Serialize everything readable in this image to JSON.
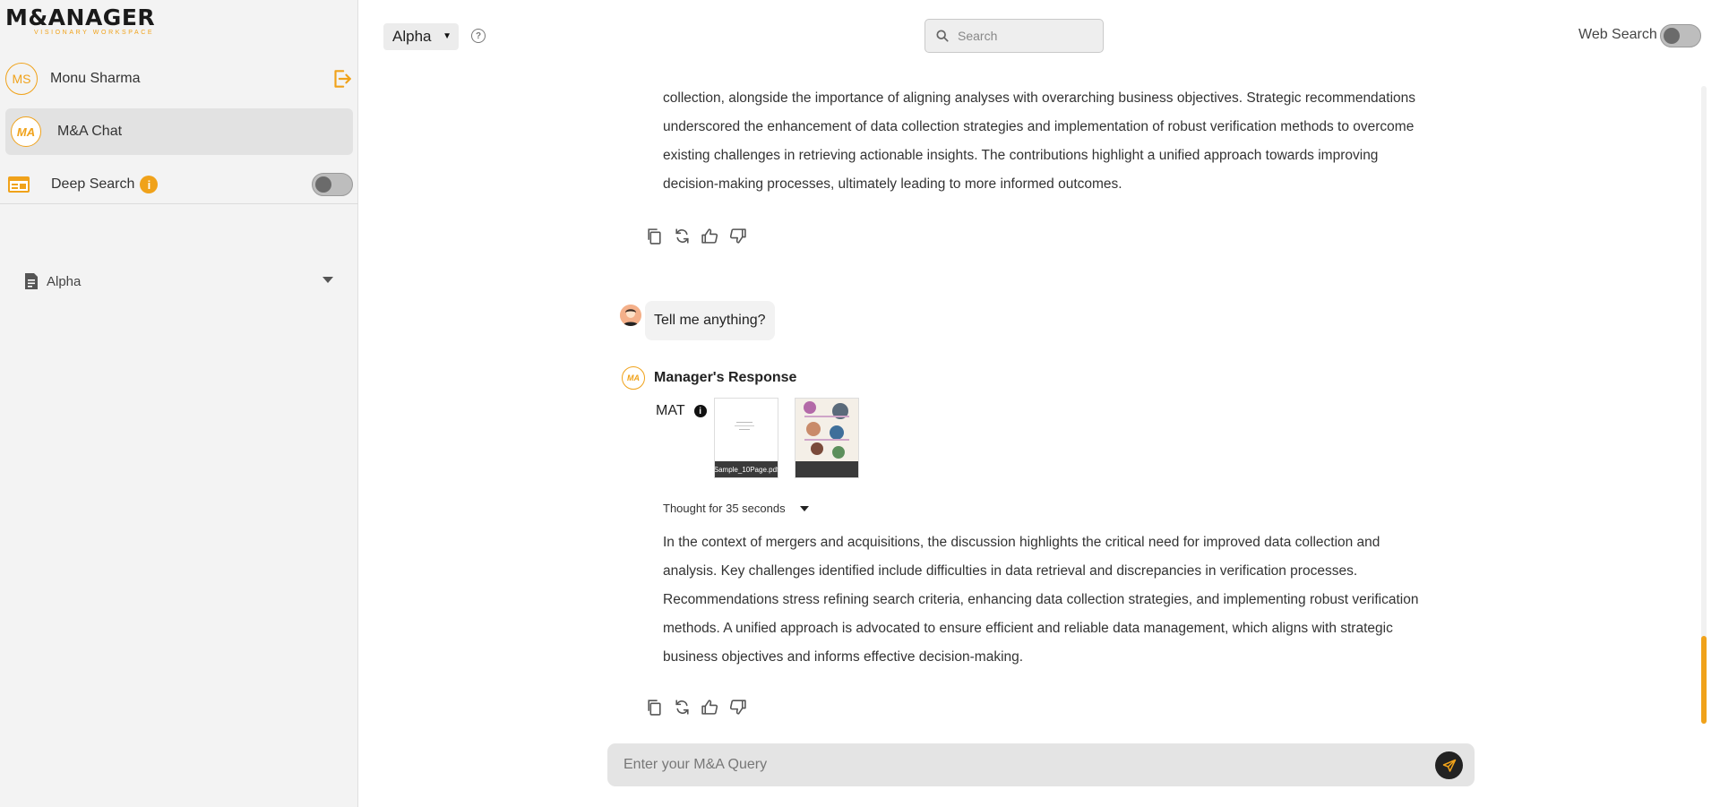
{
  "app": {
    "logo_main": "M&ANAGER",
    "logo_sub": "VISIONARY WORKSPACE"
  },
  "sidebar": {
    "user_initials": "MS",
    "user_name": "Monu Sharma",
    "chat_item": {
      "avatar": "MA",
      "label": "M&A Chat"
    },
    "deep_search": {
      "label": "Deep Search",
      "info": "i",
      "enabled": false
    },
    "folder": {
      "label": "Alpha"
    }
  },
  "topbar": {
    "model_select": "Alpha",
    "help": "?",
    "search_placeholder": "Search",
    "web_search_label": "Web Search",
    "web_search_enabled": false
  },
  "conversation": {
    "prev_response_lines": [
      "collection, alongside the importance of aligning analyses with overarching business objectives. Strategic recommendations",
      "underscored the enhancement of data collection strategies and implementation of robust verification methods to overcome",
      "existing challenges in retrieving actionable insights. The contributions highlight a unified approach towards improving",
      "decision-making processes, ultimately leading to more informed outcomes."
    ],
    "user_message": "Tell me anything?",
    "response_avatar": "MA",
    "response_title": "Manager's Response",
    "source_label": "MAT",
    "source_info": "i",
    "attachments": [
      {
        "caption": "Sample_10Page.pdf"
      },
      {
        "caption": ""
      }
    ],
    "thought_label": "Thought for 35 seconds",
    "response_lines": [
      "In the context of mergers and acquisitions, the discussion highlights the critical need for improved data collection and",
      "analysis. Key challenges identified include difficulties in data retrieval and discrepancies in verification processes.",
      "Recommendations stress refining search criteria, enhancing data collection strategies, and implementing robust verification",
      "methods. A unified approach is advocated to ensure efficient and reliable data management, which aligns with strategic",
      "business objectives and informs effective decision-making."
    ]
  },
  "query": {
    "placeholder": "Enter your M&A Query"
  },
  "colors": {
    "accent": "#f0a21a",
    "sidebar_bg": "#f3f3f3",
    "active_item_bg": "#e2e2e2",
    "input_bg": "#e4e4e4"
  },
  "icons": {
    "logout": "logout-icon",
    "deep_search": "browser-window-icon",
    "folder": "document-icon",
    "search": "search-icon",
    "copy": "copy-icon",
    "regenerate": "refresh-icon",
    "like": "thumbs-up-icon",
    "dislike": "thumbs-down-icon",
    "send": "send-icon"
  }
}
